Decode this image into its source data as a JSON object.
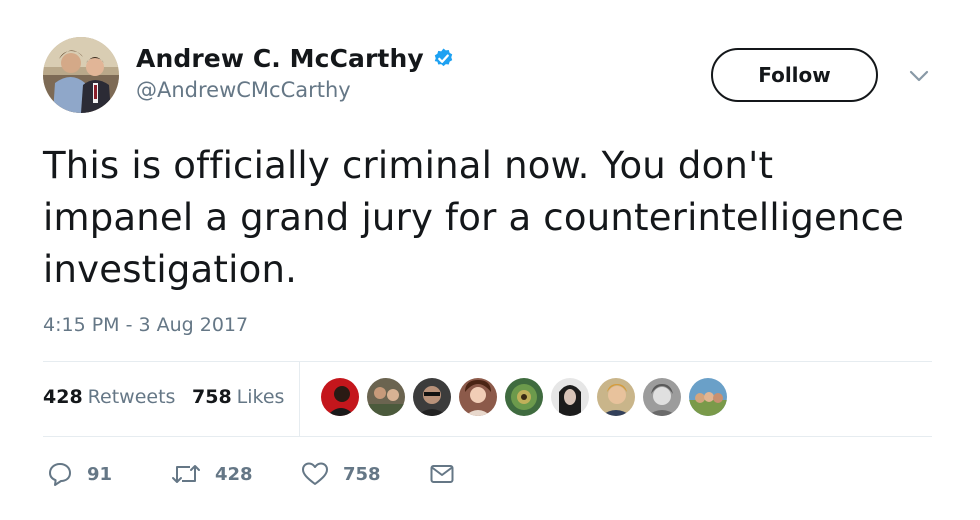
{
  "author": {
    "display_name": "Andrew C. McCarthy",
    "handle": "@AndrewCMcCarthy",
    "verified": true
  },
  "follow_label": "Follow",
  "tweet_text": "This is officially criminal now. You don't\nimpanel a grand jury for a counterintelligence\ninvestigation.",
  "timestamp": "4:15 PM - 3 Aug 2017",
  "stats": {
    "retweets_count": "428",
    "retweets_label": "Retweets",
    "likes_count": "758",
    "likes_label": "Likes"
  },
  "actions": {
    "reply_count": "91",
    "retweet_count": "428",
    "like_count": "758"
  },
  "icons": {
    "verified": "verified-badge-icon",
    "caret": "chevron-down-icon",
    "reply": "reply-icon",
    "retweet": "retweet-icon",
    "like": "heart-icon",
    "dm": "envelope-icon"
  },
  "colors": {
    "text": "#14171a",
    "secondary": "#657786",
    "verified": "#1da1f2",
    "divider": "#e6ecf0"
  }
}
